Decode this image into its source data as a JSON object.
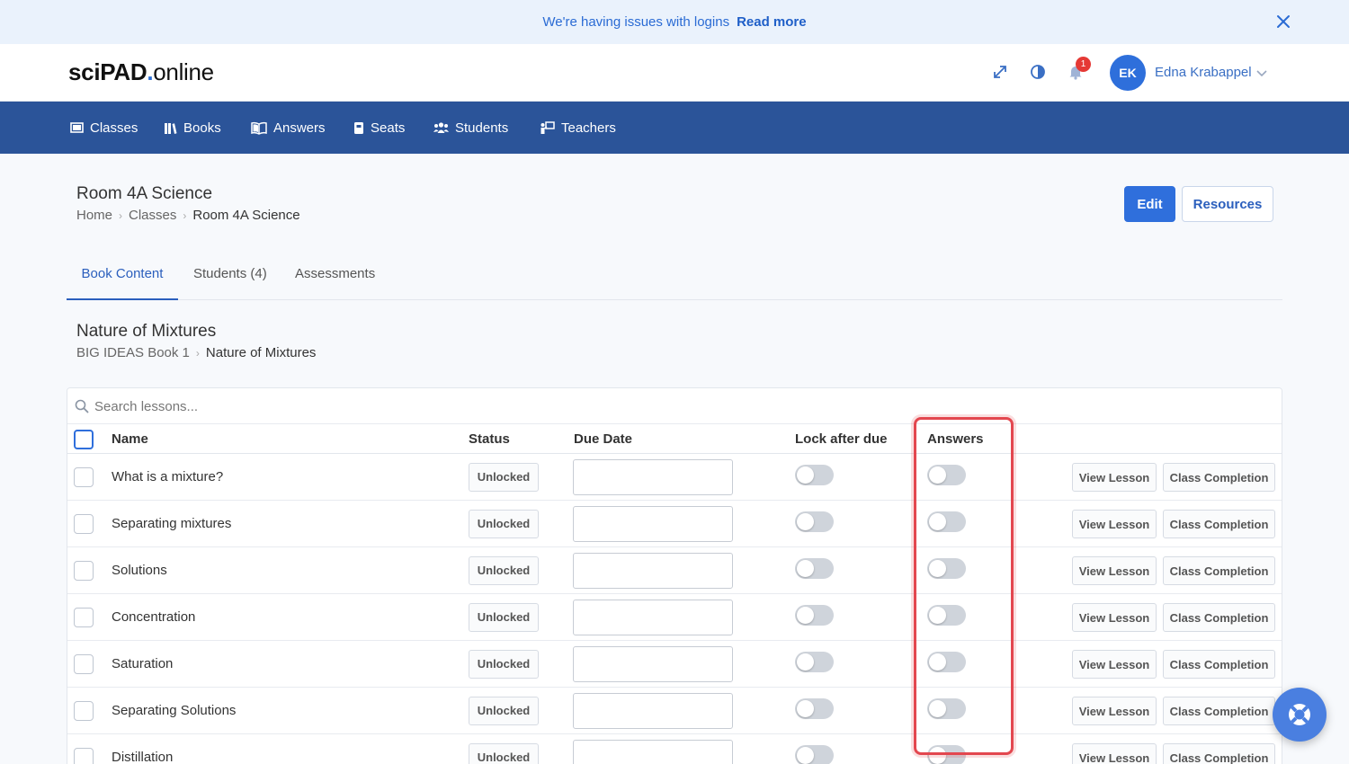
{
  "banner": {
    "message": "We're having issues with logins",
    "link": "Read more"
  },
  "logo": {
    "part1": "sciPAD",
    "dot": ".",
    "part2": "online"
  },
  "header": {
    "notification_count": "1",
    "user_initials": "EK",
    "user_name": "Edna Krabappel"
  },
  "nav": {
    "items": [
      {
        "label": "Classes",
        "icon": "classes-icon"
      },
      {
        "label": "Books",
        "icon": "books-icon"
      },
      {
        "label": "Answers",
        "icon": "book-open-icon"
      },
      {
        "label": "Seats",
        "icon": "seat-icon"
      },
      {
        "label": "Students",
        "icon": "students-icon"
      },
      {
        "label": "Teachers",
        "icon": "teacher-icon"
      }
    ]
  },
  "page": {
    "title": "Room 4A Science",
    "breadcrumb": [
      "Home",
      "Classes",
      "Room 4A Science"
    ],
    "edit_label": "Edit",
    "resources_label": "Resources"
  },
  "tabs": [
    "Book Content",
    "Students (4)",
    "Assessments"
  ],
  "section": {
    "title": "Nature of Mixtures",
    "breadcrumb": [
      "BIG IDEAS Book 1",
      "Nature of Mixtures"
    ]
  },
  "table": {
    "search_placeholder": "Search lessons...",
    "headers": {
      "name": "Name",
      "status": "Status",
      "due": "Due Date",
      "lock": "Lock after due",
      "answers": "Answers"
    },
    "rows": [
      {
        "name": "What is a mixture?",
        "status": "Unlocked"
      },
      {
        "name": "Separating mixtures",
        "status": "Unlocked"
      },
      {
        "name": "Solutions",
        "status": "Unlocked"
      },
      {
        "name": "Concentration",
        "status": "Unlocked"
      },
      {
        "name": "Saturation",
        "status": "Unlocked"
      },
      {
        "name": "Separating Solutions",
        "status": "Unlocked"
      },
      {
        "name": "Distillation",
        "status": "Unlocked"
      }
    ],
    "view_label": "View Lesson",
    "completion_label": "Class Completion"
  },
  "colors": {
    "primary": "#2f6fdc",
    "nav_bg": "#2b5499",
    "highlight": "#e3474f",
    "banner_bg": "#eaf2fc"
  }
}
